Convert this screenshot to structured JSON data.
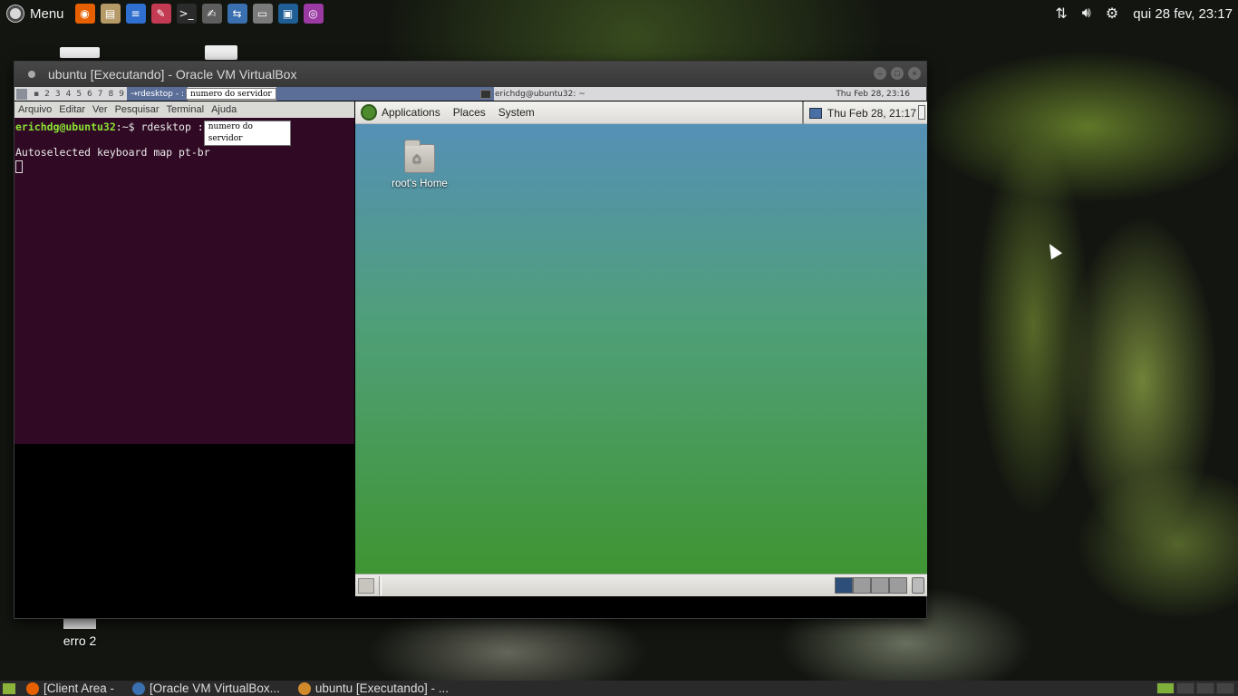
{
  "top_panel": {
    "menu_label": "Menu",
    "datetime": "qui 28 fev, 23:17",
    "launchers": [
      {
        "icon": "firefox-icon",
        "color": "#e66000",
        "glyph": "◉"
      },
      {
        "icon": "file-manager-icon",
        "color": "#b59a68",
        "glyph": "▤"
      },
      {
        "icon": "text-document-icon",
        "color": "#2f6fd0",
        "glyph": "≡"
      },
      {
        "icon": "graphics-tool-icon",
        "color": "#c23b52",
        "glyph": "✎"
      },
      {
        "icon": "terminal-icon",
        "color": "#2b2b2b",
        "glyph": ">_"
      },
      {
        "icon": "text-editor-icon",
        "color": "#5e5e5e",
        "glyph": "✍"
      },
      {
        "icon": "network-tool-icon",
        "color": "#3a6fb0",
        "glyph": "⇆"
      },
      {
        "icon": "drive-icon",
        "color": "#7a7a7a",
        "glyph": "▭"
      },
      {
        "icon": "virtualbox-icon",
        "color": "#1f5f96",
        "glyph": "▣"
      },
      {
        "icon": "media-icon",
        "color": "#9b3aa3",
        "glyph": "◎"
      }
    ]
  },
  "desktop": {
    "icon_erro2": "erro 2"
  },
  "vbox": {
    "title": "ubuntu [Executando] - Oracle VM VirtualBox",
    "guest_bar": {
      "workspaces": [
        "2",
        "3",
        "4",
        "5",
        "6",
        "7",
        "8",
        "9"
      ],
      "active_task": "→rdesktop - :",
      "tooltip": "numero do servidor",
      "terminal_title": "erichdg@ubuntu32: ~",
      "clock": "Thu Feb 28, 23:16"
    },
    "terminal": {
      "menu": [
        "Arquivo",
        "Editar",
        "Ver",
        "Pesquisar",
        "Terminal",
        "Ajuda"
      ],
      "prompt_user": "erichdg@ubuntu32",
      "prompt_path": ":~$",
      "command": " rdesktop :",
      "command_tooltip": "numero do servidor",
      "output_line": "Autoselected keyboard map pt-br"
    },
    "rdesktop": {
      "menus": [
        "Applications",
        "Places",
        "System"
      ],
      "clock": "Thu Feb 28, 21:17",
      "home_icon_label": "root's Home"
    }
  },
  "bottom_panel": {
    "tasks": [
      {
        "label": "[Client Area -",
        "icon": "firefox-icon",
        "color": "#e66000"
      },
      {
        "label": "[Oracle VM VirtualBox...",
        "icon": "virtualbox-icon",
        "color": "#3a6fb0"
      },
      {
        "label": "ubuntu [Executando] - ...",
        "icon": "virtualbox-vm-icon",
        "color": "#d08a2c"
      }
    ]
  }
}
